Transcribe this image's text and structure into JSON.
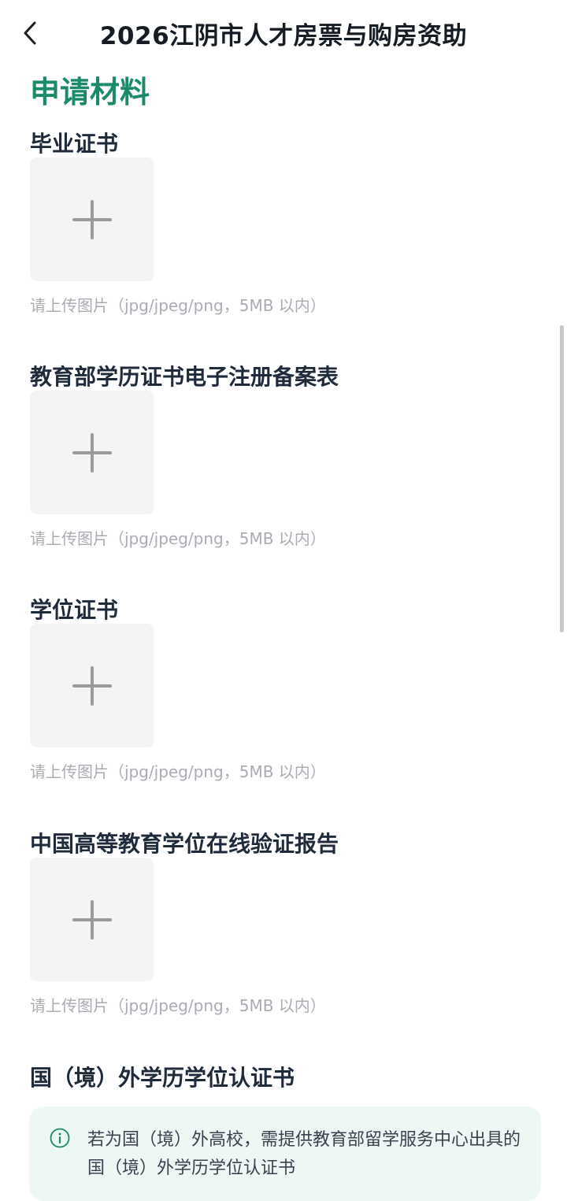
{
  "header": {
    "back_icon": "chevron-left-icon",
    "title": "2026江阴市人才房票与购房资助"
  },
  "section": {
    "title": "申请材料"
  },
  "materials": [
    {
      "label": "毕业证书",
      "hint": "请上传图片（jpg/jpeg/png，5MB 以内）"
    },
    {
      "label": "教育部学历证书电子注册备案表",
      "hint": "请上传图片（jpg/jpeg/png，5MB 以内）"
    },
    {
      "label": "学位证书",
      "hint": "请上传图片（jpg/jpeg/png，5MB 以内）"
    },
    {
      "label": "中国高等教育学位在线验证报告",
      "hint": "请上传图片（jpg/jpeg/png，5MB 以内）"
    },
    {
      "label": "国（境）外学历学位认证书"
    }
  ],
  "info": {
    "icon": "info-circle-icon",
    "text": "若为国（境）外高校，需提供教育部留学服务中心出具的国（境）外学历学位认证书"
  },
  "colors": {
    "accent": "#1b8a6b",
    "upload_bg": "#f4f4f4",
    "hint": "#a9adb3",
    "info_bg": "#edf7f3"
  }
}
